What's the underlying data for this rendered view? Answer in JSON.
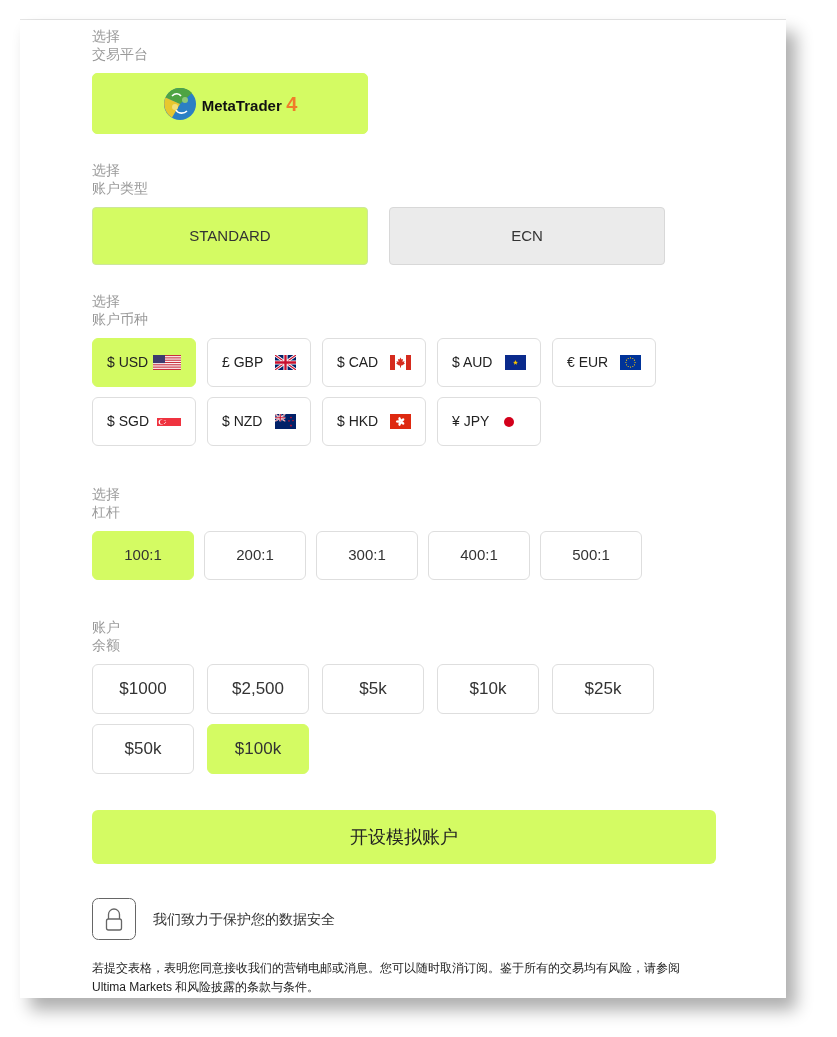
{
  "platform": {
    "label": [
      "选择",
      "交易平台"
    ],
    "options": [
      {
        "name": "MetaTrader",
        "version": "4",
        "selected": true
      }
    ]
  },
  "account_type": {
    "label": [
      "选择",
      "账户类型"
    ],
    "options": [
      {
        "label": "STANDARD",
        "selected": true
      },
      {
        "label": "ECN",
        "selected": false
      }
    ]
  },
  "currency": {
    "label": [
      "选择",
      "账户币种"
    ],
    "options": [
      {
        "label": "$ USD",
        "kind": "us",
        "selected": true
      },
      {
        "label": "£ GBP",
        "kind": "gb",
        "selected": false
      },
      {
        "label": "$ CAD",
        "kind": "ca",
        "selected": false
      },
      {
        "label": "$ AUD",
        "kind": "au",
        "selected": false
      },
      {
        "label": "€ EUR",
        "kind": "eu",
        "selected": false
      },
      {
        "label": "$ SGD",
        "kind": "sg",
        "selected": false
      },
      {
        "label": "$ NZD",
        "kind": "nz",
        "selected": false
      },
      {
        "label": "$ HKD",
        "kind": "hk",
        "selected": false
      },
      {
        "label": "¥ JPY",
        "kind": "jp",
        "selected": false
      }
    ]
  },
  "leverage": {
    "label": [
      "选择",
      "杠杆"
    ],
    "options": [
      {
        "label": "100:1",
        "selected": true
      },
      {
        "label": "200:1",
        "selected": false
      },
      {
        "label": "300:1",
        "selected": false
      },
      {
        "label": "400:1",
        "selected": false
      },
      {
        "label": "500:1",
        "selected": false
      }
    ]
  },
  "balance": {
    "label": [
      "账户",
      "余额"
    ],
    "options": [
      {
        "label": "$1000",
        "selected": false
      },
      {
        "label": "$2,500",
        "selected": false
      },
      {
        "label": "$5k",
        "selected": false
      },
      {
        "label": "$10k",
        "selected": false
      },
      {
        "label": "$25k",
        "selected": false
      },
      {
        "label": "$50k",
        "selected": false
      },
      {
        "label": "$100k",
        "selected": true
      }
    ]
  },
  "submit_button": {
    "label": "开设模拟账户"
  },
  "security_note": {
    "text": "我们致力于保护您的数据安全"
  },
  "disclaimer": "若提交表格，表明您同意接收我们的营销电邮或消息。您可以随时取消订阅。鉴于所有的交易均有风险，请参阅 Ultima Markets 和风险披露的条款与条件。"
}
